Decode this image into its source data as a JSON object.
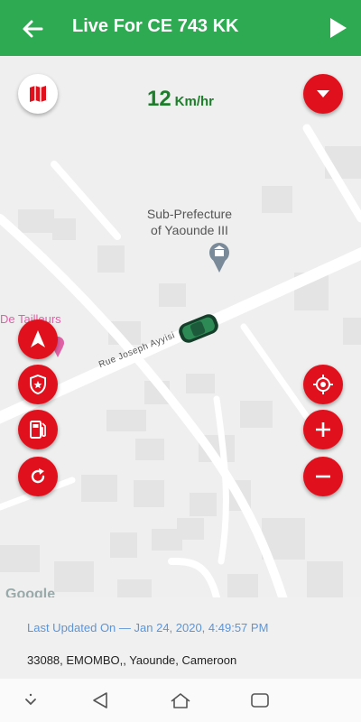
{
  "header": {
    "title": "Live For CE 743 KK",
    "back_icon": "arrow-left-icon",
    "play_icon": "play-icon",
    "color": "#2eaa52"
  },
  "speed": {
    "value": "12",
    "unit": "Km/hr",
    "color": "#1c7d2a"
  },
  "map": {
    "poi_name": "Sub-Prefecture\nof Yaounde III",
    "street_name": "Rue Joseph Ayyisi",
    "pink_label": "De Tailleurs",
    "attribution": "Google"
  },
  "buttons": {
    "map_type_icon": "map-icon",
    "dropdown_icon": "chevron-down-icon",
    "left": [
      "navigation-arrow-icon",
      "police-shield-icon",
      "fuel-pump-icon",
      "refresh-icon"
    ],
    "right": [
      "locate-target-icon",
      "zoom-in-plus-icon",
      "zoom-out-minus-icon"
    ],
    "accent": "#e0101c"
  },
  "info": {
    "updated": "Last Updated On — Jan 24, 2020, 4:49:57 PM",
    "address": "33088, EMOMBO,, Yaounde, Cameroon"
  },
  "navbar": [
    "nav-down-icon",
    "nav-back-icon",
    "nav-home-icon",
    "nav-recents-icon"
  ]
}
